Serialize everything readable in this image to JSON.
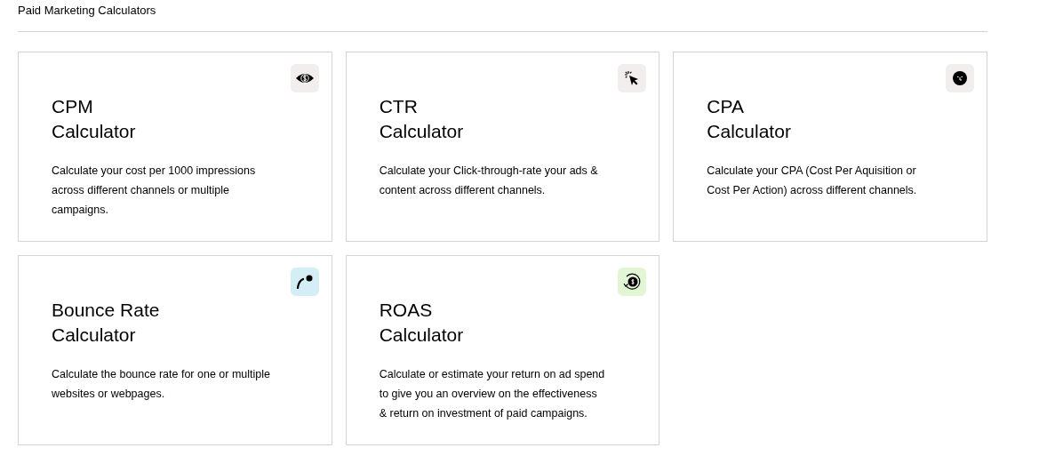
{
  "heading": "Paid Marketing Calculators",
  "cards": [
    {
      "icon": {
        "kind": "eye-dollar",
        "color": "#f1eeed"
      },
      "title_lines": [
        "CPM",
        "Calculator"
      ],
      "description": "Calculate your cost per 1000 impressions across different channels or multiple campaigns."
    },
    {
      "icon": {
        "kind": "cursor-click",
        "color": "#f1eeed"
      },
      "title_lines": [
        "CTR",
        "Calculator"
      ],
      "description": "Calculate your Click-through-rate your ads & content across different channels."
    },
    {
      "icon": {
        "kind": "face",
        "color": "#f1eeed"
      },
      "title_lines": [
        "CPA",
        "Calculator"
      ],
      "description": "Calculate your CPA (Cost Per Aquisition or Cost Per Action) across different channels."
    },
    {
      "icon": {
        "kind": "bounce",
        "color": "#d3eef5"
      },
      "title_lines": [
        "Bounce Rate",
        "Calculator"
      ],
      "description": "Calculate the bounce rate for one or multiple websites or webpages."
    },
    {
      "icon": {
        "kind": "coin-cycle",
        "color": "#e2f6d5"
      },
      "title_lines": [
        "ROAS",
        "Calculator"
      ],
      "description": "Calculate or estimate your return on ad spend to give you an overview on the effectiveness & return on investment of paid campaigns."
    }
  ]
}
